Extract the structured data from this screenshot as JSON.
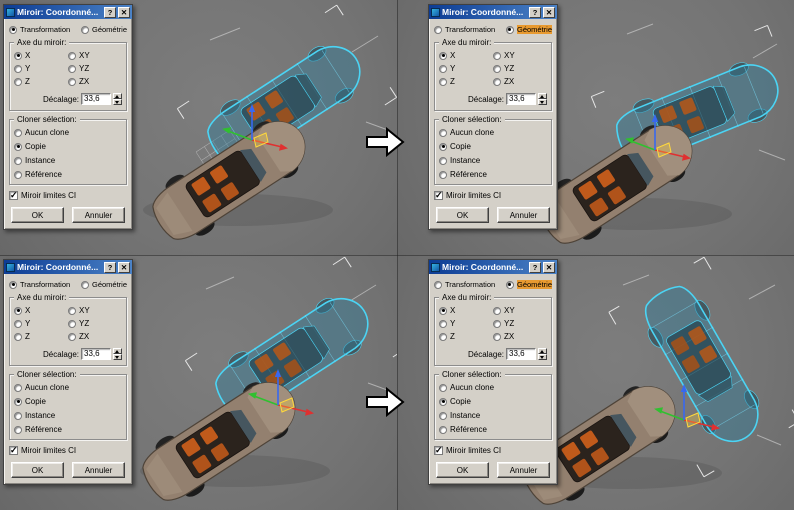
{
  "dialog": {
    "title": "Miroir: Coordonné...",
    "help_button": "?",
    "close_button": "✕",
    "modes": {
      "transformation": "Transformation",
      "geometrie": "Géométrie"
    },
    "axis_group": "Axe du miroir:",
    "axis_options": {
      "x": "X",
      "y": "Y",
      "z": "Z",
      "xy": "XY",
      "yz": "YZ",
      "zx": "ZX"
    },
    "offset_label": "Décalage:",
    "offset_value": "33,6",
    "clone_group": "Cloner sélection:",
    "clone_options": {
      "aucun": "Aucun clone",
      "copie": "Copie",
      "instance": "Instance",
      "reference": "Référence"
    },
    "mirror_ik": "Miroir limites CI",
    "ok": "OK",
    "cancel": "Annuler"
  },
  "panels": [
    {
      "name": "top-left",
      "mode": "transformation",
      "axis": "x",
      "clone": "copie",
      "mirror_ik_checked": true
    },
    {
      "name": "top-right",
      "mode": "geometrie",
      "axis": "x",
      "clone": "copie",
      "mirror_ik_checked": true
    },
    {
      "name": "bottom-left",
      "mode": "transformation",
      "axis": "x",
      "clone": "copie",
      "mirror_ik_checked": true
    },
    {
      "name": "bottom-right",
      "mode": "geometrie",
      "axis": "x",
      "clone": "copie",
      "mirror_ik_checked": true
    }
  ],
  "colors": {
    "viewport_bg": "#747474",
    "dialog_bg": "#d4d0c8",
    "titlebar_left": "#0c3c94",
    "titlebar_right": "#4b82c6",
    "car_body": "#93806f",
    "seat_orange": "#c05a1b",
    "mirror_fill": "#2e7d9c",
    "mirror_stroke": "#4bd4f4",
    "gizmo_x": "#e03030",
    "gizmo_y": "#30c030",
    "gizmo_z": "#3868f0",
    "gizmo_plane": "#ffd83c",
    "mode_highlight": "#e89a30"
  }
}
